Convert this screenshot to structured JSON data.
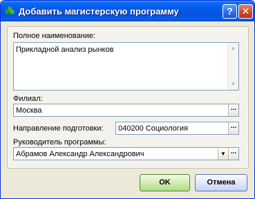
{
  "window": {
    "title": "Добавить магистерскую программу",
    "help_label": "?",
    "close_label": "✕"
  },
  "form": {
    "fullname_label": "Полное наименование:",
    "fullname_value": "Прикладной анализ рынков",
    "branch_label": "Филиал:",
    "branch_value": "Москва",
    "direction_label": "Направление подготовки:",
    "direction_value": "040200 Социология",
    "head_label": "Руководитель программы:",
    "head_value": "Абрамов Александр Александрович",
    "browse_label": "...",
    "dropdown_arrow": "▼"
  },
  "buttons": {
    "ok": "OK",
    "cancel": "Отмена"
  },
  "colors": {
    "titlebar": "#0553e0",
    "dialog_bg": "#ece9d8",
    "field_border": "#7f9db9"
  }
}
